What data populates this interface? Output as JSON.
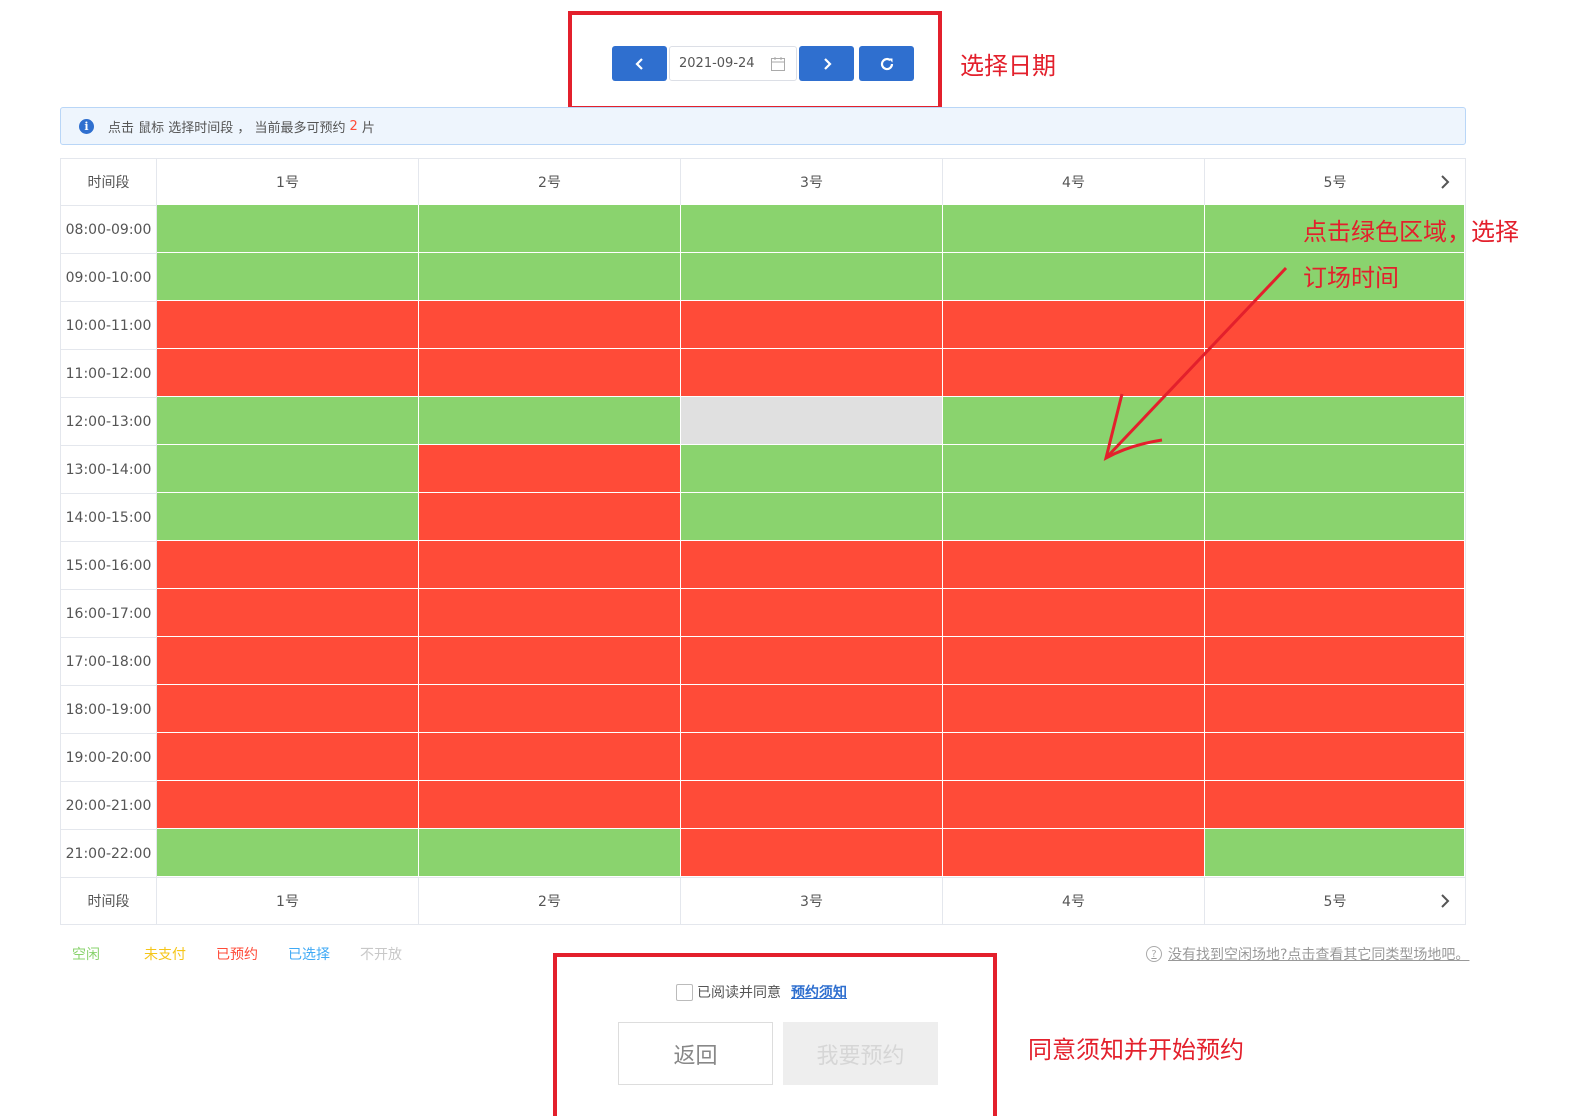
{
  "date_nav": {
    "prev_icon": "chevron-left-icon",
    "date_value": "2021-09-24",
    "calendar_icon": "calendar-icon",
    "next_icon": "chevron-right-icon",
    "refresh_icon": "refresh-icon"
  },
  "annotations": {
    "select_date": "选择日期",
    "click_green_line1": "点击绿色区域，选择",
    "click_green_line2": "订场时间",
    "agree_and_book": "同意须知并开始预约"
  },
  "info_bar": {
    "text_before": "点击 鼠标 选择时间段 ， 当前最多可预约",
    "count": "2",
    "text_after": "片"
  },
  "grid": {
    "time_header": "时间段",
    "courts": [
      "1号",
      "2号",
      "3号",
      "4号",
      "5号"
    ],
    "next_icon": "chevron-right-icon",
    "status_colors": {
      "free": "#8ad36e",
      "booked": "#ff4b38",
      "closed": "#e0e0e0"
    },
    "rows": [
      {
        "time": "08:00-09:00",
        "slots": [
          "free",
          "free",
          "free",
          "free",
          "free"
        ]
      },
      {
        "time": "09:00-10:00",
        "slots": [
          "free",
          "free",
          "free",
          "free",
          "free"
        ]
      },
      {
        "time": "10:00-11:00",
        "slots": [
          "booked",
          "booked",
          "booked",
          "booked",
          "booked"
        ]
      },
      {
        "time": "11:00-12:00",
        "slots": [
          "booked",
          "booked",
          "booked",
          "booked",
          "booked"
        ]
      },
      {
        "time": "12:00-13:00",
        "slots": [
          "free",
          "free",
          "closed",
          "free",
          "free"
        ]
      },
      {
        "time": "13:00-14:00",
        "slots": [
          "free",
          "booked",
          "free",
          "free",
          "free"
        ]
      },
      {
        "time": "14:00-15:00",
        "slots": [
          "free",
          "booked",
          "free",
          "free",
          "free"
        ]
      },
      {
        "time": "15:00-16:00",
        "slots": [
          "booked",
          "booked",
          "booked",
          "booked",
          "booked"
        ]
      },
      {
        "time": "16:00-17:00",
        "slots": [
          "booked",
          "booked",
          "booked",
          "booked",
          "booked"
        ]
      },
      {
        "time": "17:00-18:00",
        "slots": [
          "booked",
          "booked",
          "booked",
          "booked",
          "booked"
        ]
      },
      {
        "time": "18:00-19:00",
        "slots": [
          "booked",
          "booked",
          "booked",
          "booked",
          "booked"
        ]
      },
      {
        "time": "19:00-20:00",
        "slots": [
          "booked",
          "booked",
          "booked",
          "booked",
          "booked"
        ]
      },
      {
        "time": "20:00-21:00",
        "slots": [
          "booked",
          "booked",
          "booked",
          "booked",
          "booked"
        ]
      },
      {
        "time": "21:00-22:00",
        "slots": [
          "free",
          "free",
          "booked",
          "booked",
          "free"
        ]
      }
    ]
  },
  "legend": [
    {
      "label": "空闲",
      "color": "#8ad36e"
    },
    {
      "label": "未支付",
      "color": "#f5c518"
    },
    {
      "label": "已预约",
      "color": "#ff4b38"
    },
    {
      "label": "已选择",
      "color": "#3fa9f5"
    },
    {
      "label": "不开放",
      "color": "#c8c8c8"
    }
  ],
  "no_found_link": "没有找到空闲场地?点击查看其它同类型场地吧。",
  "agreement": {
    "read_label": "已阅读并同意",
    "notice_link": "预约须知"
  },
  "buttons": {
    "back": "返回",
    "book": "我要预约"
  }
}
